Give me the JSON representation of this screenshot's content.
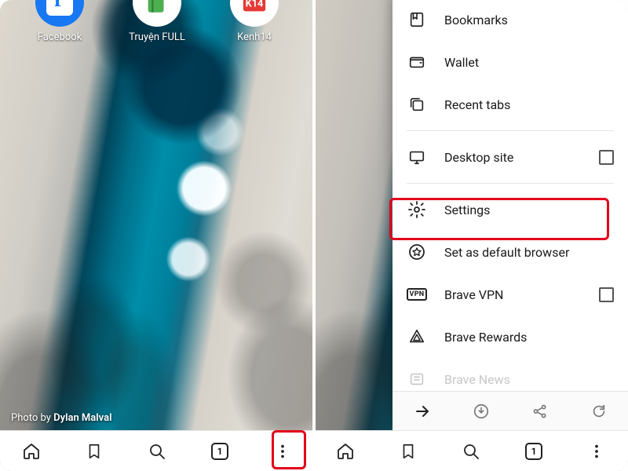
{
  "left": {
    "apps": [
      {
        "label": "Facebook"
      },
      {
        "label": "Truyện FULL"
      },
      {
        "label": "Kenh14"
      }
    ],
    "credit_prefix": "Photo by ",
    "credit_name": "Dylan Malval",
    "tab_count": "1"
  },
  "right": {
    "tab_count": "1",
    "menu": {
      "bookmarks": "Bookmarks",
      "wallet": "Wallet",
      "recent_tabs": "Recent tabs",
      "desktop_site": "Desktop site",
      "settings": "Settings",
      "default_browser": "Set as default browser",
      "vpn": "Brave VPN",
      "vpn_badge": "VPN",
      "rewards": "Brave Rewards",
      "news": "Brave News"
    }
  }
}
